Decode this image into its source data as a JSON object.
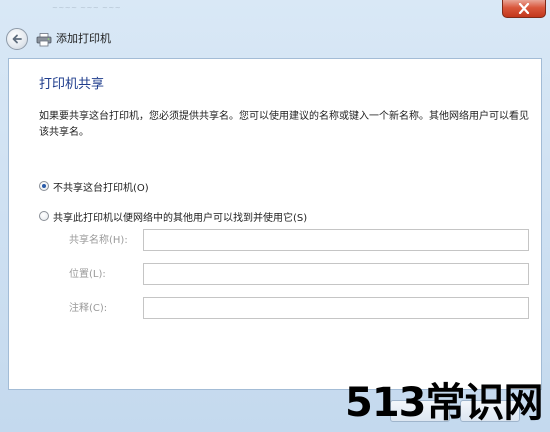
{
  "window": {
    "title_ghost": "~~~~ ~~~ ~~~"
  },
  "nav": {
    "title": "添加打印机"
  },
  "page": {
    "heading": "打印机共享",
    "description": "如果要共享这台打印机，您必须提供共享名。您可以使用建议的名称或键入一个新名称。其他网络用户可以看见该共享名。"
  },
  "options": {
    "no_share_label": "不共享这台打印机(O)",
    "share_label": "共享此打印机以便网络中的其他用户可以找到并使用它(S)",
    "selected": "no_share"
  },
  "fields": {
    "share_name_label": "共享名称(H):",
    "share_name_value": "",
    "location_label": "位置(L):",
    "location_value": "",
    "comment_label": "注释(C):",
    "comment_value": ""
  },
  "watermark": {
    "text": "513常识网"
  },
  "colors": {
    "heading": "#1e3c8c",
    "close_button": "#c2371c",
    "window_bg": "#c4d9ee"
  }
}
